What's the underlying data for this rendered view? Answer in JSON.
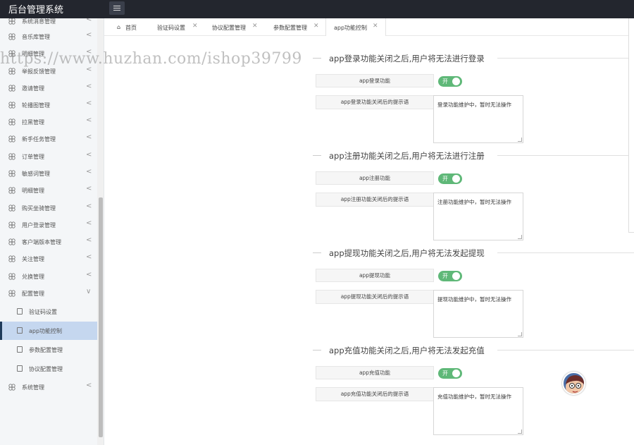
{
  "app": {
    "title": "后台管理系统"
  },
  "icons": {
    "menu": "hamburger-icon",
    "home": "home-icon",
    "nav": "clover-icon",
    "doc": "document-icon",
    "close": "close-icon",
    "chevron": "chevron-icon"
  },
  "colors": {
    "topbar": "#23262e",
    "toggle_on": "#5fb878",
    "active_item": "#c5d7ef"
  },
  "sidebar": {
    "items": [
      {
        "label": "系统消息管理",
        "chev": "<"
      },
      {
        "label": "音乐库管理",
        "chev": "<"
      },
      {
        "label": "明细管理",
        "chev": "<"
      },
      {
        "label": "举报反馈管理",
        "chev": "<"
      },
      {
        "label": "邀请管理",
        "chev": "<"
      },
      {
        "label": "轮播图管理",
        "chev": "<"
      },
      {
        "label": "拉黑管理",
        "chev": "<"
      },
      {
        "label": "新手任务管理",
        "chev": "<"
      },
      {
        "label": "订单管理",
        "chev": "<"
      },
      {
        "label": "敏感词管理",
        "chev": "<"
      },
      {
        "label": "明细管理",
        "chev": "<"
      },
      {
        "label": "购买坐骑管理",
        "chev": "<"
      },
      {
        "label": "用户登录管理",
        "chev": "<"
      },
      {
        "label": "客户端版本管理",
        "chev": "<"
      },
      {
        "label": "关注管理",
        "chev": "<"
      },
      {
        "label": "兑换管理",
        "chev": "<"
      },
      {
        "label": "配置管理",
        "chev": "∨"
      }
    ],
    "sub_items": [
      {
        "label": "验证码设置"
      },
      {
        "label": "app功能控制"
      },
      {
        "label": "参数配置管理"
      },
      {
        "label": "协议配置管理"
      }
    ],
    "last_item": {
      "label": "系统管理",
      "chev": "<"
    }
  },
  "tabs": [
    {
      "label": "首页",
      "close": ""
    },
    {
      "label": "验证码设置",
      "close": "✕"
    },
    {
      "label": "协议配置管理",
      "close": "✕"
    },
    {
      "label": "参数配置管理",
      "close": "✕"
    },
    {
      "label": "app功能控制",
      "close": "✕"
    }
  ],
  "sections": [
    {
      "title": "app登录功能关闭之后,用户将无法进行登录",
      "switch_label": "app登录功能",
      "switch_text": "开",
      "hint_label": "app登录功能关闭后的提示语",
      "hint_value": "登录功能维护中，暂时无法操作"
    },
    {
      "title": "app注册功能关闭之后,用户将无法进行注册",
      "switch_label": "app注册功能",
      "switch_text": "开",
      "hint_label": "app注册功能关闭后的提示语",
      "hint_value": "注册功能维护中，暂时无法操作"
    },
    {
      "title": "app提现功能关闭之后,用户将无法发起提现",
      "switch_label": "app提现功能",
      "switch_text": "开",
      "hint_label": "app提现功能关闭后的提示语",
      "hint_value": "提现功能维护中，暂时无法操作"
    },
    {
      "title": "app充值功能关闭之后,用户将无法发起充值",
      "switch_label": "app充值功能",
      "switch_text": "开",
      "hint_label": "app充值功能关闭后的提示语",
      "hint_value": "充值功能维护中，暂时无法操作"
    }
  ],
  "watermark": "https://www.huzhan.com/ishop39799"
}
